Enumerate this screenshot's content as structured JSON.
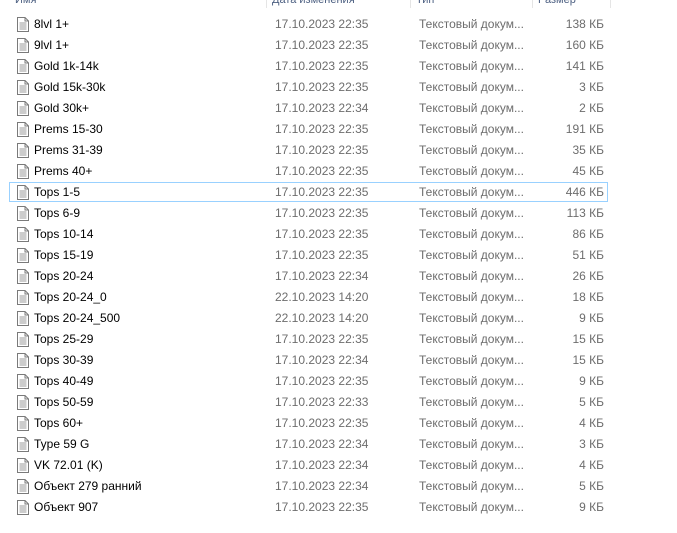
{
  "header": {
    "name": "Имя",
    "date": "Дата изменения",
    "type": "Тип",
    "size": "Размер"
  },
  "files": [
    {
      "name": "8lvl 1+",
      "date": "17.10.2023 22:35",
      "type": "Текстовый докум...",
      "size": "138 КБ",
      "icon": "text-document-icon"
    },
    {
      "name": "9lvl 1+",
      "date": "17.10.2023 22:35",
      "type": "Текстовый докум...",
      "size": "160 КБ",
      "icon": "text-document-icon"
    },
    {
      "name": "Gold 1k-14k",
      "date": "17.10.2023 22:35",
      "type": "Текстовый докум...",
      "size": "141 КБ",
      "icon": "text-document-icon"
    },
    {
      "name": "Gold 15k-30k",
      "date": "17.10.2023 22:35",
      "type": "Текстовый докум...",
      "size": "3 КБ",
      "icon": "text-document-icon"
    },
    {
      "name": "Gold 30k+",
      "date": "17.10.2023 22:34",
      "type": "Текстовый докум...",
      "size": "2 КБ",
      "icon": "text-document-icon"
    },
    {
      "name": "Prems 15-30",
      "date": "17.10.2023 22:35",
      "type": "Текстовый докум...",
      "size": "191 КБ",
      "icon": "text-document-icon"
    },
    {
      "name": "Prems 31-39",
      "date": "17.10.2023 22:35",
      "type": "Текстовый докум...",
      "size": "35 КБ",
      "icon": "text-document-icon"
    },
    {
      "name": "Prems 40+",
      "date": "17.10.2023 22:35",
      "type": "Текстовый докум...",
      "size": "45 КБ",
      "icon": "text-document-icon"
    },
    {
      "name": "Tops 1-5",
      "date": "17.10.2023 22:35",
      "type": "Текстовый докум...",
      "size": "446 КБ",
      "icon": "text-document-icon",
      "selected": true
    },
    {
      "name": "Tops 6-9",
      "date": "17.10.2023 22:35",
      "type": "Текстовый докум...",
      "size": "113 КБ",
      "icon": "text-document-icon"
    },
    {
      "name": "Tops 10-14",
      "date": "17.10.2023 22:35",
      "type": "Текстовый докум...",
      "size": "86 КБ",
      "icon": "text-document-icon"
    },
    {
      "name": "Tops 15-19",
      "date": "17.10.2023 22:35",
      "type": "Текстовый докум...",
      "size": "51 КБ",
      "icon": "text-document-icon"
    },
    {
      "name": "Tops 20-24",
      "date": "17.10.2023 22:34",
      "type": "Текстовый докум...",
      "size": "26 КБ",
      "icon": "text-document-icon"
    },
    {
      "name": "Tops 20-24_0",
      "date": "22.10.2023 14:20",
      "type": "Текстовый докум...",
      "size": "18 КБ",
      "icon": "text-document-icon"
    },
    {
      "name": "Tops 20-24_500",
      "date": "22.10.2023 14:20",
      "type": "Текстовый докум...",
      "size": "9 КБ",
      "icon": "text-document-icon"
    },
    {
      "name": "Tops 25-29",
      "date": "17.10.2023 22:35",
      "type": "Текстовый докум...",
      "size": "15 КБ",
      "icon": "text-document-icon"
    },
    {
      "name": "Tops 30-39",
      "date": "17.10.2023 22:34",
      "type": "Текстовый докум...",
      "size": "15 КБ",
      "icon": "text-document-icon"
    },
    {
      "name": "Tops 40-49",
      "date": "17.10.2023 22:35",
      "type": "Текстовый докум...",
      "size": "9 КБ",
      "icon": "text-document-icon"
    },
    {
      "name": "Tops 50-59",
      "date": "17.10.2023 22:33",
      "type": "Текстовый докум...",
      "size": "5 КБ",
      "icon": "text-document-icon"
    },
    {
      "name": "Tops 60+",
      "date": "17.10.2023 22:35",
      "type": "Текстовый докум...",
      "size": "4 КБ",
      "icon": "text-document-icon"
    },
    {
      "name": "Type 59 G",
      "date": "17.10.2023 22:34",
      "type": "Текстовый докум...",
      "size": "3 КБ",
      "icon": "text-document-icon"
    },
    {
      "name": "VK 72.01 (K)",
      "date": "17.10.2023 22:34",
      "type": "Текстовый докум...",
      "size": "4 КБ",
      "icon": "text-document-icon"
    },
    {
      "name": "Объект 279 ранний",
      "date": "17.10.2023 22:34",
      "type": "Текстовый докум...",
      "size": "5 КБ",
      "icon": "text-document-icon"
    },
    {
      "name": "Объект 907",
      "date": "17.10.2023 22:35",
      "type": "Текстовый докум...",
      "size": "9 КБ",
      "icon": "text-document-icon"
    }
  ]
}
